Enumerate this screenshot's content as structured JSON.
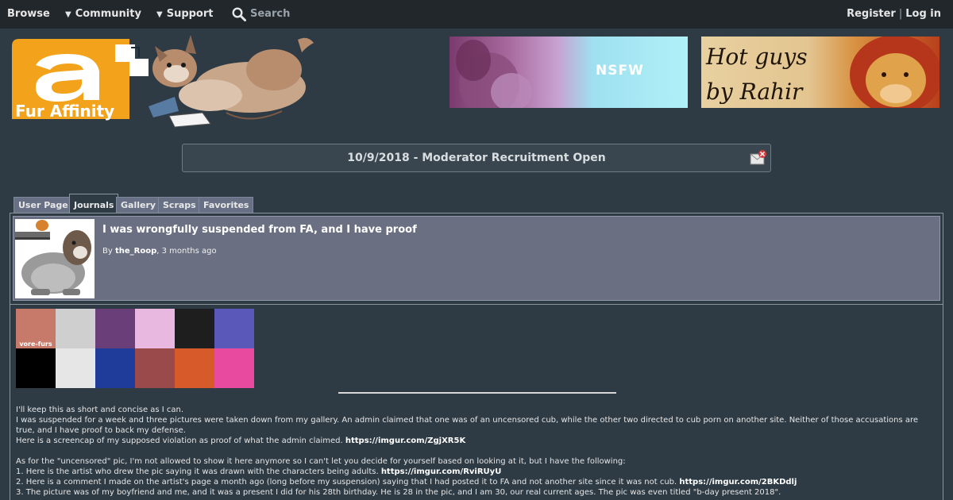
{
  "nav": {
    "browse": "Browse",
    "community": "Community",
    "support": "Support",
    "search_placeholder": "Search",
    "register": "Register",
    "separator": "|",
    "login": "Log in"
  },
  "logo": {
    "text": "Fur Affinity"
  },
  "banners": [
    {
      "text": "NSFW"
    },
    {
      "line1": "Hot guys",
      "line2": "by Rahir"
    }
  ],
  "notice": {
    "text": "10/9/2018 - Moderator Recruitment Open"
  },
  "tabs": [
    {
      "label": "User Page",
      "active": false
    },
    {
      "label": "Journals",
      "active": true
    },
    {
      "label": "Gallery",
      "active": false
    },
    {
      "label": "Scraps",
      "active": false
    },
    {
      "label": "Favorites",
      "active": false
    }
  ],
  "journal": {
    "title": "I was wrongfully suspended from FA, and I have proof",
    "by_label": "By",
    "author": "the_Roop",
    "time": ", 3 months ago",
    "stamps": [
      {
        "label": "vore-furs",
        "color": "#c77a6a"
      },
      {
        "label": "",
        "color": "#cfcfcf"
      },
      {
        "label": "",
        "color": "#6a3e78"
      },
      {
        "label": "",
        "color": "#e9b8e0"
      },
      {
        "label": "",
        "color": "#1e1e1e"
      },
      {
        "label": "",
        "color": "#5a58b8"
      },
      {
        "label": "",
        "color": "#000000"
      },
      {
        "label": "",
        "color": "#e6e6e6"
      },
      {
        "label": "",
        "color": "#1f3c9a"
      },
      {
        "label": "",
        "color": "#9a4a4a"
      },
      {
        "label": "",
        "color": "#d65a2a"
      },
      {
        "label": "",
        "color": "#e84aa0"
      }
    ],
    "paragraphs": [
      {
        "text": "I'll keep this as short and concise as I can."
      },
      {
        "text": "I was suspended for a week and three pictures were taken down from my gallery. An admin claimed that one was of an uncensored cub, while the other two directed to cub porn on another site. Neither of those accusations are true, and I have proof to back my defense."
      },
      {
        "text": "Here is a screencap of my supposed violation as proof of what the admin claimed. ",
        "link": "https://imgur.com/ZgjXR5K"
      },
      {
        "gap": true
      },
      {
        "text": "As for the \"uncensored\" pic, I'm not allowed to show it here anymore so I can't let you decide for yourself based on looking at it, but I have the following:"
      },
      {
        "text": "1. Here is the artist who drew the pic saying it was drawn with the characters being adults. ",
        "link": "https://imgur.com/RviRUyU"
      },
      {
        "text": "2. Here is a comment I made on the artist's page a month ago (long before my suspension) saying that I had posted it to FA and not another site since it was not cub. ",
        "link": "https://imgur.com/2BKDdlj"
      },
      {
        "text": "3. The picture was of my boyfriend and me, and it was a present I did for his 28th birthday. He is 28 in the pic, and I am 30, our real current ages. The pic was even titled \"b-day present 2018\"."
      }
    ]
  }
}
